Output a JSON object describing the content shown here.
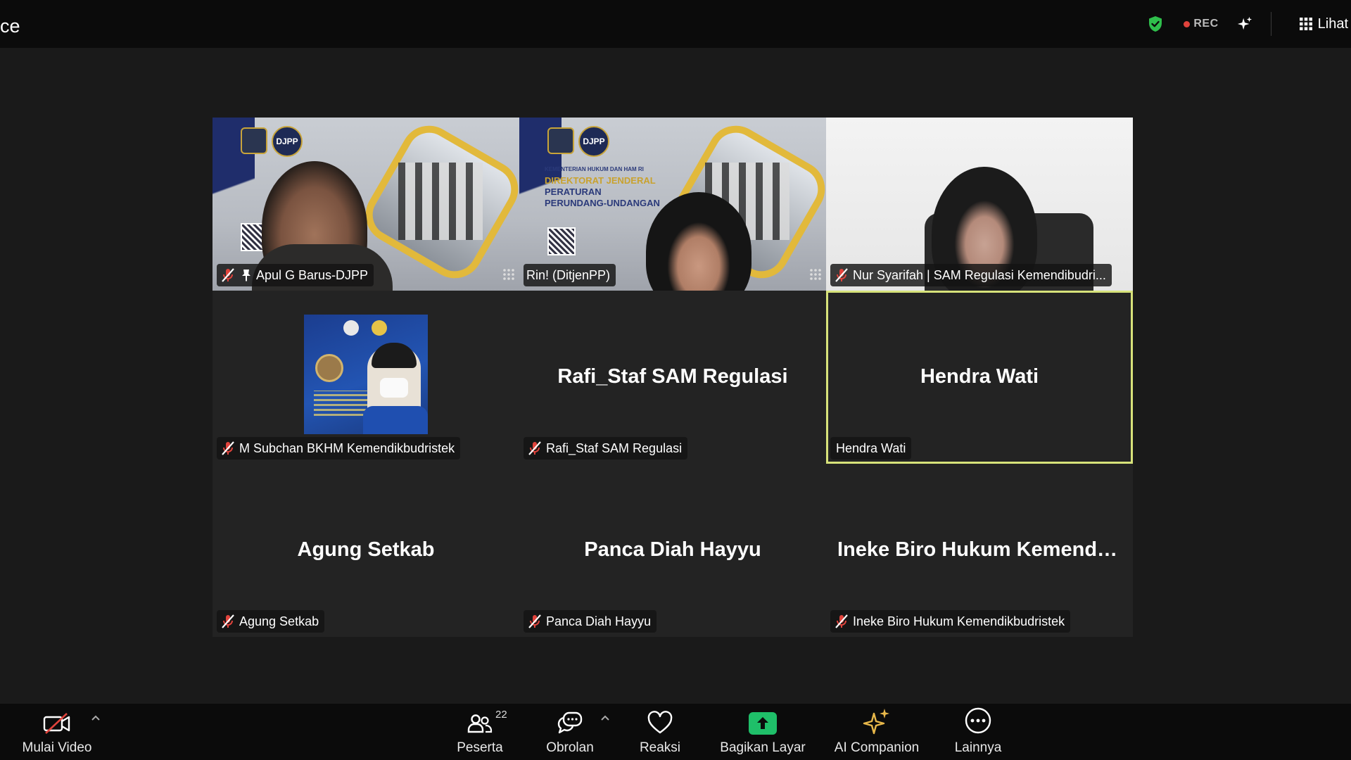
{
  "window": {
    "title_fragment": "ce"
  },
  "topbar": {
    "rec_label": "REC",
    "view_label": "Lihat",
    "colors": {
      "shield": "#2fbf4c",
      "rec_dot": "#e0433c"
    }
  },
  "gallery": {
    "tiles": [
      {
        "name": "Apul G Barus-DJPP",
        "muted": true,
        "pinned": true,
        "video": "slide-background"
      },
      {
        "name": "Rin! (DitjenPP)",
        "muted": false,
        "video": "slide-background"
      },
      {
        "name": "Nur Syarifah | SAM Regulasi Kemendibudri...",
        "muted": true,
        "video": "camera"
      },
      {
        "name": "M Subchan BKHM Kemendikbudristek",
        "muted": true,
        "video": "profile-picture"
      },
      {
        "name": "Rafi_Staf SAM Regulasi",
        "center_name": "Rafi_Staf SAM Regulasi",
        "muted": true
      },
      {
        "name": "Hendra Wati",
        "center_name": "Hendra Wati",
        "muted": false,
        "active_speaker": true
      },
      {
        "name": "Agung Setkab",
        "center_name": "Agung Setkab",
        "muted": true
      },
      {
        "name": "Panca Diah Hayyu",
        "center_name": "Panca Diah Hayyu",
        "muted": true
      },
      {
        "name": "Ineke Biro Hukum Kemendikbudristek",
        "center_name": "Ineke Biro Hukum Kemendikb...",
        "muted": true
      }
    ],
    "slide": {
      "logo_text": "DJPP",
      "text_1": "KEMENTERIAN HUKUM DAN HAM RI",
      "text_2": "DIREKTORAT JENDERAL",
      "text_3": "PERATURAN",
      "text_4": "PERUNDANG-UNDANGAN"
    },
    "active_color": "#d7e27a"
  },
  "toolbar": {
    "video": {
      "label": "Mulai Video",
      "icon": "video-off-icon"
    },
    "participants": {
      "label": "Peserta",
      "count": "22",
      "icon": "participants-icon"
    },
    "chat": {
      "label": "Obrolan",
      "icon": "chat-icon"
    },
    "reactions": {
      "label": "Reaksi",
      "icon": "heart-icon"
    },
    "share": {
      "label": "Bagikan Layar",
      "icon": "share-screen-icon",
      "color": "#1fbf69"
    },
    "ai": {
      "label": "AI Companion",
      "icon": "ai-sparkle-icon",
      "color": "#e8b84a"
    },
    "more": {
      "label": "Lainnya",
      "icon": "more-icon"
    }
  }
}
